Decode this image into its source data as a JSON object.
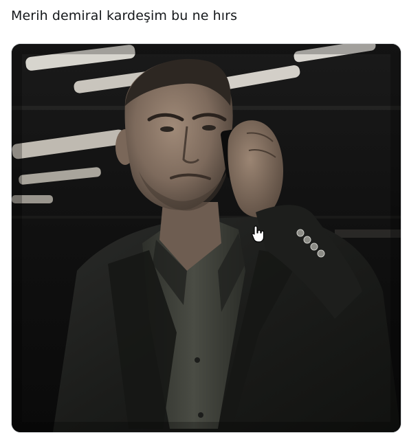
{
  "tweet": {
    "text": "Merih demiral kardeşim bu ne hırs"
  },
  "media": {
    "type": "photo",
    "subject": "man in dark suit on phone",
    "colors": {
      "background": "#0b0b0b",
      "light_strip": "#e9e6df",
      "suit": "#1f201e",
      "shirt": "#3c3e37",
      "skin": "#8a7666"
    }
  },
  "cursor": {
    "icon": "hand-pointer-icon"
  }
}
